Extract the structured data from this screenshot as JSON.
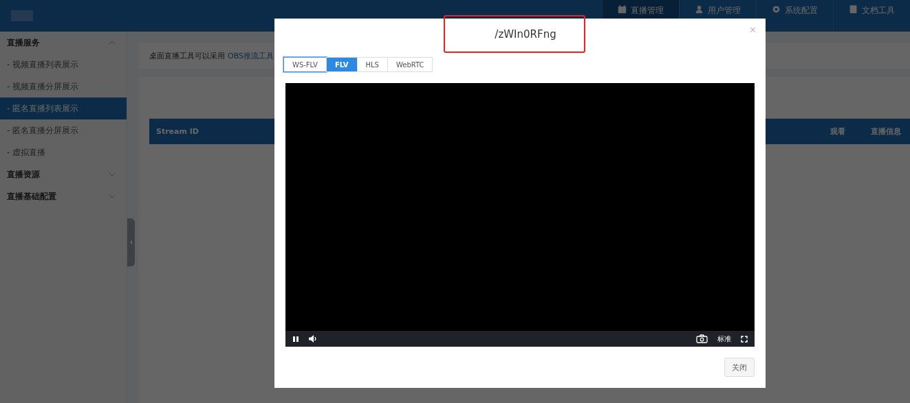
{
  "header": {
    "nav": [
      {
        "label": "直播管理",
        "selected": true
      },
      {
        "label": "用户管理",
        "selected": false
      },
      {
        "label": "系统配置",
        "selected": false
      },
      {
        "label": "文档工具",
        "selected": false
      }
    ]
  },
  "sidebar": {
    "groups": [
      {
        "label": "直播服务",
        "expanded": true,
        "children": [
          {
            "label": "- 视频直播列表展示",
            "selected": false
          },
          {
            "label": "- 视频直播分屏展示",
            "selected": false
          },
          {
            "label": "- 匿名直播列表展示",
            "selected": true
          },
          {
            "label": "- 匿名直播分屏展示",
            "selected": false
          },
          {
            "label": "- 虚拟直播",
            "selected": false
          }
        ]
      },
      {
        "label": "直播资源",
        "expanded": false
      },
      {
        "label": "直播基础配置",
        "expanded": false
      }
    ]
  },
  "notice": {
    "text": "桌面直播工具可以采用",
    "link": "OBS推流工具"
  },
  "table": {
    "columns": [
      {
        "label": "Stream ID"
      },
      {
        "label": "观看"
      },
      {
        "label": "直播信息"
      }
    ]
  },
  "dialog": {
    "title": "/zWIn0RFng",
    "close": "×",
    "tabs": [
      {
        "label": "WS-FLV",
        "selected": false,
        "focused": true
      },
      {
        "label": "FLV",
        "selected": true,
        "focused": false
      },
      {
        "label": "HLS",
        "selected": false,
        "focused": false
      },
      {
        "label": "WebRTC",
        "selected": false,
        "focused": false
      }
    ],
    "player": {
      "playing": true,
      "quality": "标准"
    },
    "buttons": [
      "关闭"
    ]
  }
}
